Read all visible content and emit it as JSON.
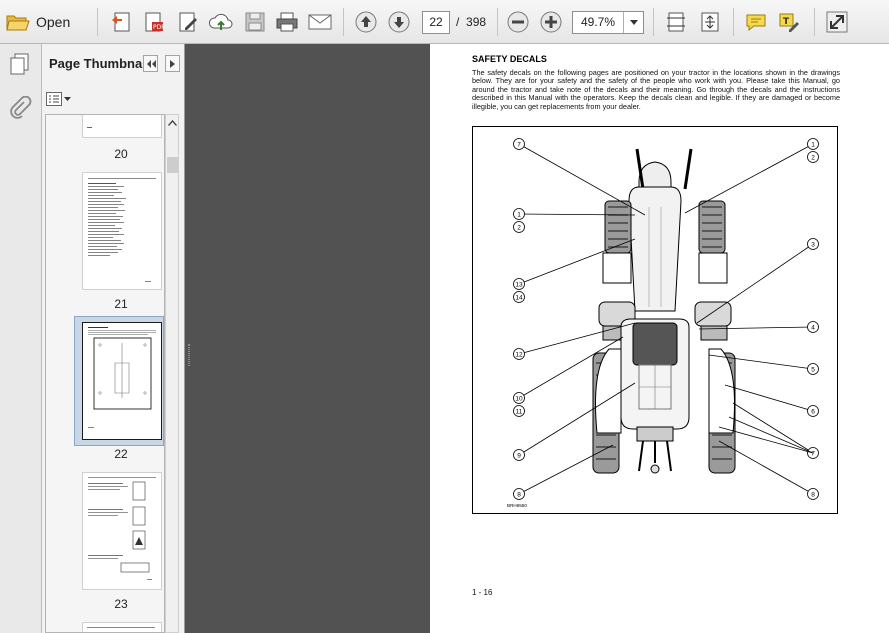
{
  "toolbar": {
    "open_label": "Open",
    "current_page": "22",
    "page_separator": "/",
    "total_pages": "398",
    "zoom": "49.7%"
  },
  "sidebar": {
    "title": "Page Thumbna...",
    "thumbnails": [
      {
        "label": "20"
      },
      {
        "label": "21"
      },
      {
        "label": "22"
      },
      {
        "label": "23"
      }
    ]
  },
  "document": {
    "section_title": "SAFETY DECALS",
    "intro": "The safety decals on the following pages are positioned on your tractor in the locations shown in the drawings below. They are for your safety and the safety of the people who work with you. Please take this Manual, go around the tractor and take note of the decals and their meaning. Go through the decals and the instructions described in this Manual with the operators. Keep the decals clean and legible. If they are damaged or become illegible, you can get replacements from your dealer.",
    "figure_code": "BRH6550",
    "callouts": [
      "7",
      "1",
      "2",
      "1",
      "2",
      "3",
      "13",
      "14",
      "4",
      "12",
      "5",
      "10",
      "11",
      "6",
      "9",
      "7",
      "8",
      "8"
    ],
    "page_number": "1 - 16"
  }
}
